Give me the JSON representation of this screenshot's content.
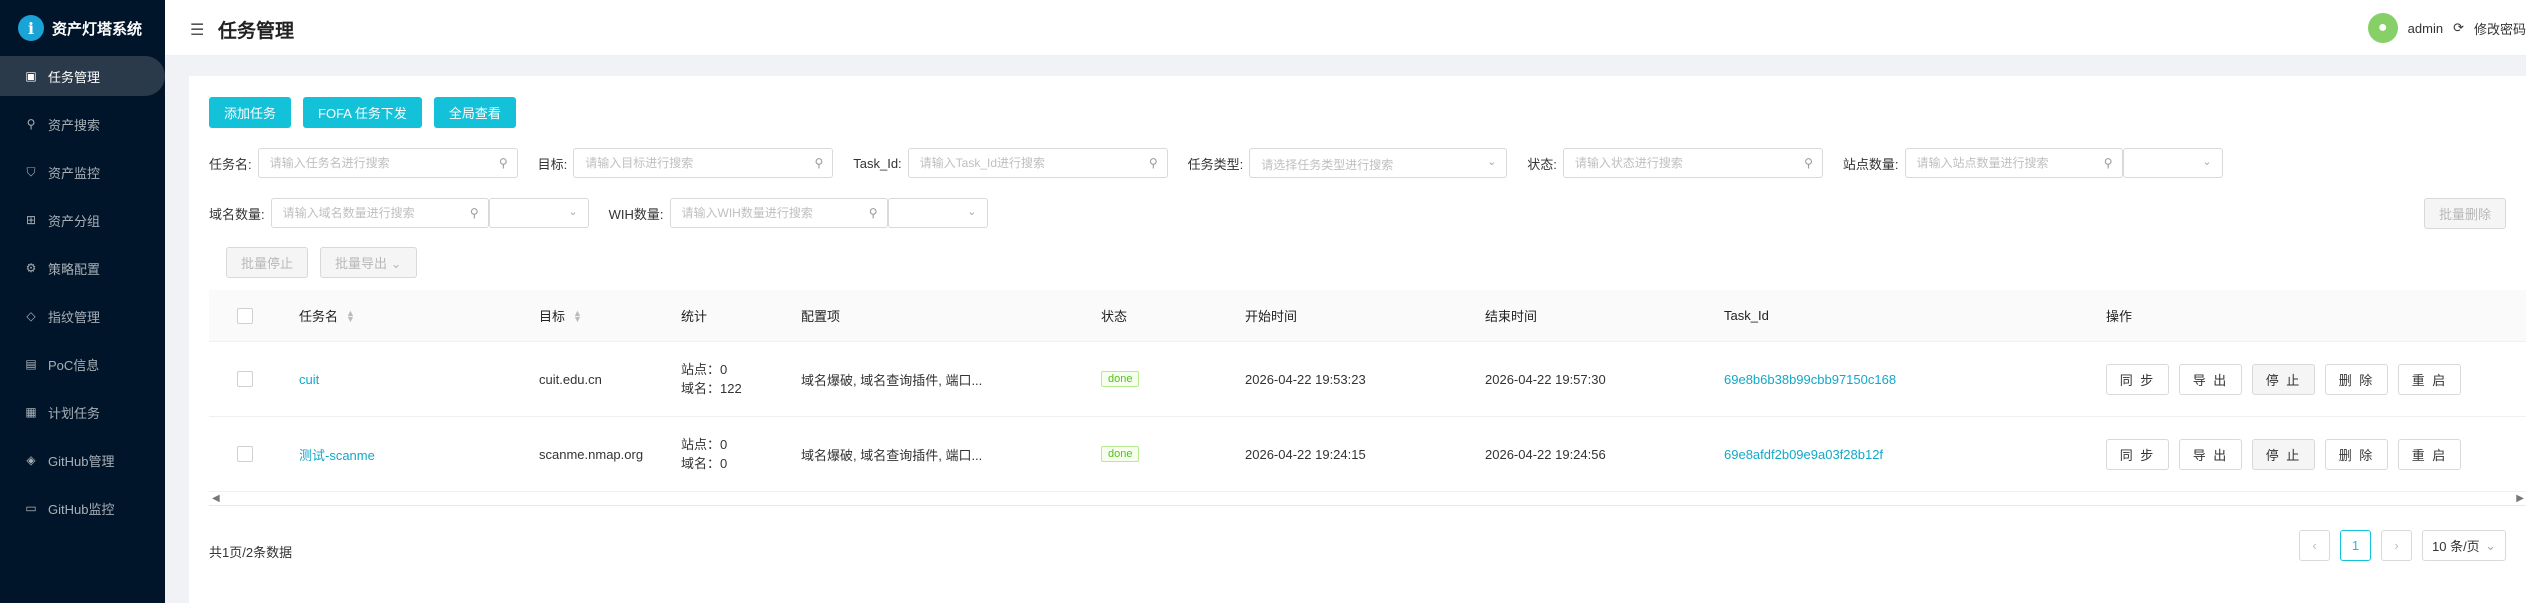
{
  "app": {
    "title": "资产灯塔系统",
    "logo_letter": "i"
  },
  "sidebar": {
    "items": [
      {
        "label": "任务管理",
        "icon": "task-icon",
        "glyph": "▣",
        "active": true
      },
      {
        "label": "资产搜索",
        "icon": "search-icon",
        "glyph": "⚲"
      },
      {
        "label": "资产监控",
        "icon": "shield-icon",
        "glyph": "⛉"
      },
      {
        "label": "资产分组",
        "icon": "cluster-icon",
        "glyph": "⊞"
      },
      {
        "label": "策略配置",
        "icon": "gear-icon",
        "glyph": "⚙"
      },
      {
        "label": "指纹管理",
        "icon": "tag-icon",
        "glyph": "◇"
      },
      {
        "label": "PoC信息",
        "icon": "file-icon",
        "glyph": "▤"
      },
      {
        "label": "计划任务",
        "icon": "calendar-icon",
        "glyph": "▦"
      },
      {
        "label": "GitHub管理",
        "icon": "github-icon",
        "glyph": "◈"
      },
      {
        "label": "GitHub监控",
        "icon": "laptop-icon",
        "glyph": "▭"
      }
    ]
  },
  "header": {
    "title": "任务管理",
    "menu_glyph": "☰",
    "user": "admin",
    "logout_glyph": "⟳",
    "change_password": "修改密码"
  },
  "toolbar": {
    "add_task": "添加任务",
    "fofa": "FOFA 任务下发",
    "global_view": "全局查看",
    "batch_delete": "批量删除",
    "batch_stop": "批量停止",
    "batch_export": "批量导出"
  },
  "filters": {
    "task_name": {
      "label": "任务名:",
      "placeholder": "请输入任务名进行搜索"
    },
    "target": {
      "label": "目标:",
      "placeholder": "请输入目标进行搜索"
    },
    "task_id": {
      "label": "Task_Id:",
      "placeholder": "请输入Task_Id进行搜索"
    },
    "task_type": {
      "label": "任务类型:",
      "placeholder": "请选择任务类型进行搜索"
    },
    "status": {
      "label": "状态:",
      "placeholder": "请输入状态进行搜索"
    },
    "site_count": {
      "label": "站点数量:",
      "placeholder": "请输入站点数量进行搜索"
    },
    "domain_count": {
      "label": "域名数量:",
      "placeholder": "请输入域名数量进行搜索"
    },
    "wih_count": {
      "label": "WIH数量:",
      "placeholder": "请输入WIH数量进行搜索"
    }
  },
  "table": {
    "columns": {
      "name": "任务名",
      "target": "目标",
      "stats": "统计",
      "config": "配置项",
      "status": "状态",
      "start": "开始时间",
      "end": "结束时间",
      "task_id": "Task_Id",
      "ops": "操作"
    },
    "rows": [
      {
        "name": "cuit",
        "target": "cuit.edu.cn",
        "site": "站点：0",
        "domain": "域名：122",
        "config": "域名爆破, 域名查询插件, 端口...",
        "status": "done",
        "start": "2026-04-22 19:53:23",
        "end": "2026-04-22 19:57:30",
        "task_id": "69e8b6b38b99cbb97150c168"
      },
      {
        "name": "测试-scanme",
        "target": "scanme.nmap.org",
        "site": "站点：0",
        "domain": "域名：0",
        "config": "域名爆破, 域名查询插件, 端口...",
        "status": "done",
        "start": "2026-04-22 19:24:15",
        "end": "2026-04-22 19:24:56",
        "task_id": "69e8afdf2b09e9a03f28b12f"
      }
    ],
    "ops": {
      "sync": "同 步",
      "export": "导 出",
      "stop": "停 止",
      "delete": "删 除",
      "restart": "重 启"
    }
  },
  "pagination": {
    "summary": "共1页/2条数据",
    "prev": "‹",
    "next": "›",
    "current": "1",
    "page_size": "10 条/页"
  },
  "colors": {
    "accent": "#13c2d9",
    "sidebar": "#001529",
    "link": "#13a8c9",
    "done": "#52c41a"
  }
}
